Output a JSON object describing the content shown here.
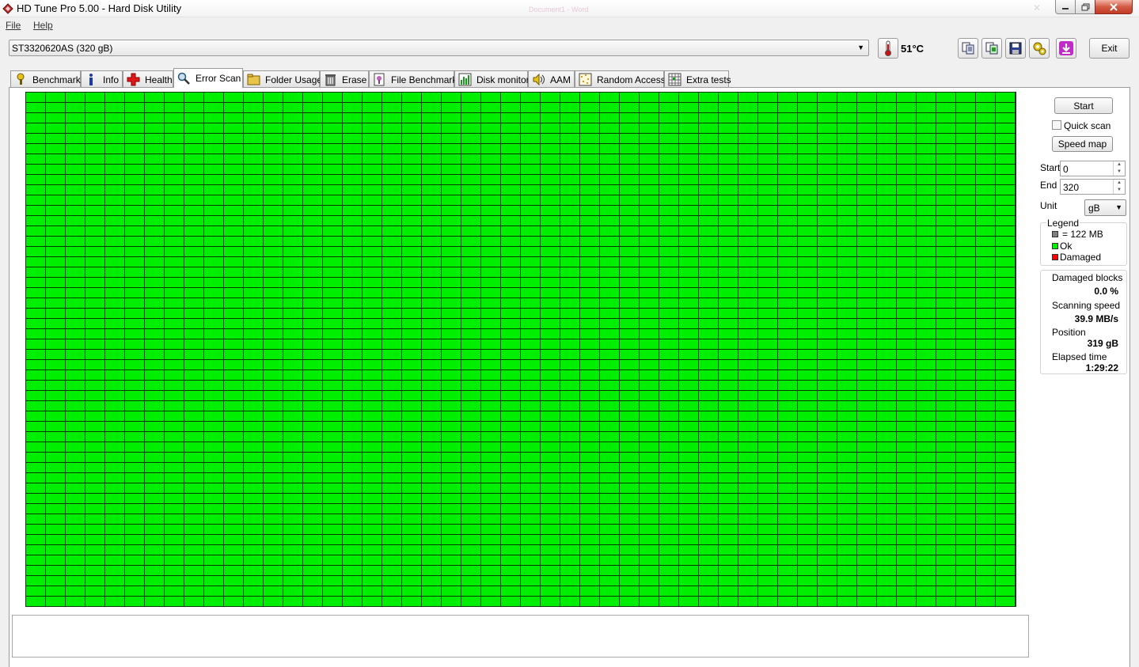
{
  "window": {
    "title": "HD Tune Pro 5.00 - Hard Disk Utility",
    "ghost_title": "Document1 - Word"
  },
  "menu": {
    "file": "File",
    "help": "Help"
  },
  "toolbar": {
    "drive": "ST3320620AS (320 gB)",
    "temperature": "51°C",
    "exit_label": "Exit",
    "icons": [
      "copy-text-icon",
      "copy-screenshot-icon",
      "save-icon",
      "options-icon",
      "download-icon"
    ]
  },
  "tabs": [
    {
      "label": "Benchmark",
      "icon": "benchmark-icon"
    },
    {
      "label": "Info",
      "icon": "info-icon"
    },
    {
      "label": "Health",
      "icon": "health-cross-icon"
    },
    {
      "label": "Error Scan",
      "icon": "magnifier-icon",
      "active": true
    },
    {
      "label": "Folder Usage",
      "icon": "folder-icon"
    },
    {
      "label": "Erase",
      "icon": "trash-icon"
    },
    {
      "label": "File Benchmark",
      "icon": "file-benchmark-icon"
    },
    {
      "label": "Disk monitor",
      "icon": "disk-monitor-icon"
    },
    {
      "label": "AAM",
      "icon": "speaker-icon"
    },
    {
      "label": "Random Access",
      "icon": "random-access-icon"
    },
    {
      "label": "Extra tests",
      "icon": "extra-tests-icon"
    }
  ],
  "controls": {
    "start_button": "Start",
    "quick_scan": "Quick scan",
    "quick_scan_checked": false,
    "speed_map_button": "Speed map",
    "start_label": "Start",
    "start_value": "0",
    "end_label": "End",
    "end_value": "320",
    "unit_label": "Unit",
    "unit_value": "gB"
  },
  "legend": {
    "title": "Legend",
    "block_size": "= 122 MB",
    "ok": "Ok",
    "damaged": "Damaged",
    "colors": {
      "block": "#808080",
      "ok": "#00ee00",
      "damaged": "#ff0000"
    }
  },
  "stats": {
    "damaged_blocks_label": "Damaged blocks",
    "damaged_blocks_value": "0.0 %",
    "scanning_speed_label": "Scanning speed",
    "scanning_speed_value": "39.9 MB/s",
    "position_label": "Position",
    "position_value": "319 gB",
    "elapsed_label": "Elapsed time",
    "elapsed_value": "1:29:22"
  },
  "scan_grid": {
    "columns": 50,
    "rows": 50,
    "status": "ok",
    "color": "#00ee00"
  }
}
